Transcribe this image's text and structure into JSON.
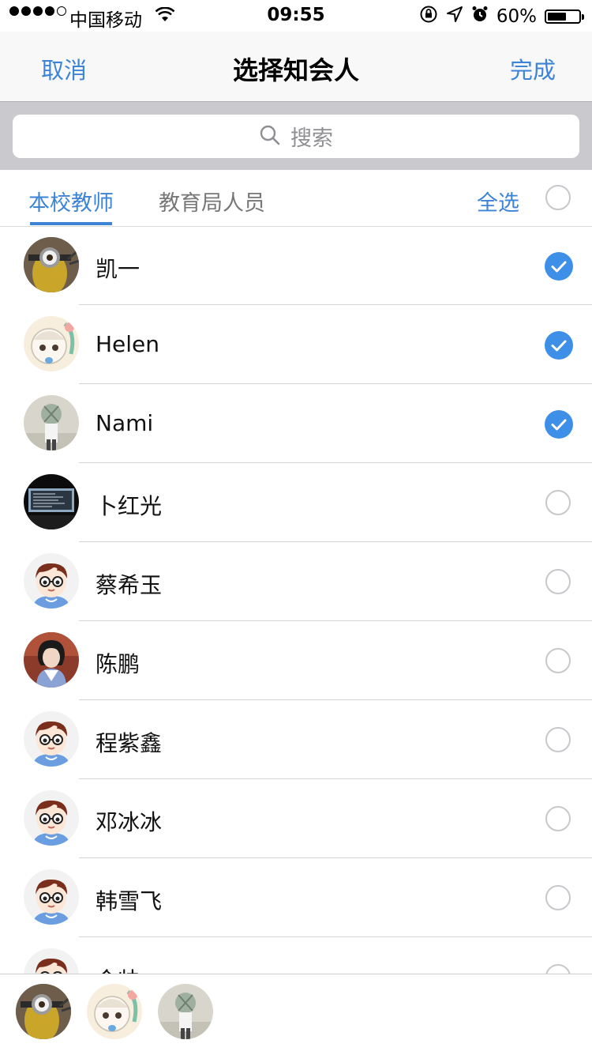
{
  "status_bar": {
    "carrier": "中国移动",
    "time": "09:55",
    "battery": "60%",
    "battery_level": 0.6,
    "icons": [
      "signal-dots",
      "wifi-icon",
      "rotation-lock-icon",
      "location-arrow-icon",
      "alarm-icon",
      "battery-icon"
    ]
  },
  "nav": {
    "cancel": "取消",
    "title": "选择知会人",
    "done": "完成"
  },
  "search": {
    "placeholder": "搜索"
  },
  "tabs": {
    "items": [
      "本校教师",
      "教育局人员"
    ],
    "active": 0,
    "select_all": "全选"
  },
  "contacts": [
    {
      "name": "凯一",
      "checked": true,
      "avatar": "minion"
    },
    {
      "name": "Helen",
      "checked": true,
      "avatar": "cartoon-girl"
    },
    {
      "name": "Nami",
      "checked": true,
      "avatar": "photo-person"
    },
    {
      "name": "卜红光",
      "checked": false,
      "avatar": "monitor"
    },
    {
      "name": "蔡希玉",
      "checked": false,
      "avatar": "default-boy"
    },
    {
      "name": "陈鹏",
      "checked": false,
      "avatar": "photo-woman"
    },
    {
      "name": "程紫鑫",
      "checked": false,
      "avatar": "default-boy"
    },
    {
      "name": "邓冰冰",
      "checked": false,
      "avatar": "default-boy"
    },
    {
      "name": "韩雪飞",
      "checked": false,
      "avatar": "default-boy"
    },
    {
      "name": "金帅",
      "checked": false,
      "avatar": "default-boy"
    }
  ],
  "selected_bar": [
    "minion",
    "cartoon-girl",
    "photo-person"
  ],
  "colors": {
    "accent": "#3d84d6",
    "check": "#3d8fe8",
    "search_bg": "#c9c9ce"
  }
}
